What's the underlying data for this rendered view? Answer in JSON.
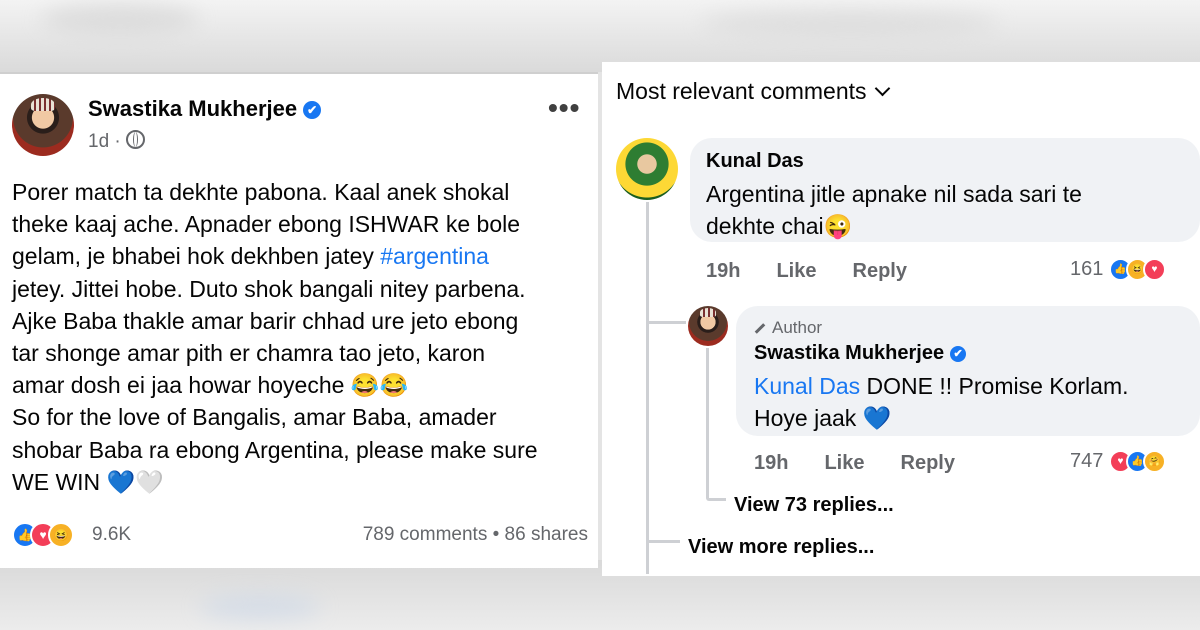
{
  "post": {
    "author": "Swastika Mukherjee",
    "verified_mark": "✔",
    "time": "1d",
    "separator": "·",
    "more_label": "•••",
    "body_lines": [
      "Porer match ta dekhte pabona. Kaal anek shokal",
      "theke kaaj ache. Apnader ebong ISHWAR ke bole",
      "gelam, je bhabei hok dekhben jatey ",
      "jetey. Jittei hobe. Duto shok bangali nitey parbena.",
      "Ajke Baba thakle amar barir chhad ure jeto ebong",
      "tar shonge amar pith er chamra tao jeto, karon",
      "amar dosh ei jaa howar hoyeche 😂😂",
      "So for the love of Bangalis, amar Baba, amader",
      "shobar Baba ra ebong Argentina, please make sure",
      "WE WIN 💙🤍"
    ],
    "hashtag": "#argentina",
    "reaction_icons": [
      "like-icon",
      "love-icon",
      "haha-icon"
    ],
    "reaction_count": "9.6K",
    "comments_count": "789 comments",
    "dot": "•",
    "shares_count": "86 shares"
  },
  "comments": {
    "sort_label": "Most relevant comments",
    "items": [
      {
        "name": "Kunal Das",
        "text_line1": "Argentina jitle apnake nil sada sari te",
        "text_line2": "dekhte chai😜",
        "time": "19h",
        "like_label": "Like",
        "reply_label": "Reply",
        "reaction_count": "161",
        "reaction_icons": [
          "like-icon",
          "haha-icon",
          "love-icon"
        ]
      },
      {
        "badge": "Author",
        "name": "Swastika Mukherjee",
        "mention": "Kunal Das",
        "text_line1_rest": " DONE !! Promise Korlam.",
        "text_line2": "Hoye jaak 💙",
        "time": "19h",
        "like_label": "Like",
        "reply_label": "Reply",
        "reaction_count": "747",
        "reaction_icons": [
          "love-icon",
          "like-icon",
          "care-icon"
        ]
      }
    ],
    "view_replies": "View 73 replies...",
    "view_more": "View more replies..."
  },
  "colors": {
    "facebook_blue": "#1877f2",
    "secondary_text": "#65676b",
    "bubble_bg": "#f0f2f5"
  }
}
